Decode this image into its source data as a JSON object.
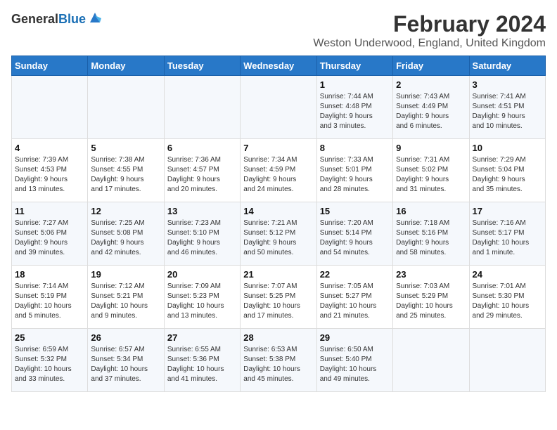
{
  "logo": {
    "general": "General",
    "blue": "Blue"
  },
  "header": {
    "title": "February 2024",
    "subtitle": "Weston Underwood, England, United Kingdom"
  },
  "weekdays": [
    "Sunday",
    "Monday",
    "Tuesday",
    "Wednesday",
    "Thursday",
    "Friday",
    "Saturday"
  ],
  "rows": [
    [
      {
        "day": "",
        "info": ""
      },
      {
        "day": "",
        "info": ""
      },
      {
        "day": "",
        "info": ""
      },
      {
        "day": "",
        "info": ""
      },
      {
        "day": "1",
        "info": "Sunrise: 7:44 AM\nSunset: 4:48 PM\nDaylight: 9 hours\nand 3 minutes."
      },
      {
        "day": "2",
        "info": "Sunrise: 7:43 AM\nSunset: 4:49 PM\nDaylight: 9 hours\nand 6 minutes."
      },
      {
        "day": "3",
        "info": "Sunrise: 7:41 AM\nSunset: 4:51 PM\nDaylight: 9 hours\nand 10 minutes."
      }
    ],
    [
      {
        "day": "4",
        "info": "Sunrise: 7:39 AM\nSunset: 4:53 PM\nDaylight: 9 hours\nand 13 minutes."
      },
      {
        "day": "5",
        "info": "Sunrise: 7:38 AM\nSunset: 4:55 PM\nDaylight: 9 hours\nand 17 minutes."
      },
      {
        "day": "6",
        "info": "Sunrise: 7:36 AM\nSunset: 4:57 PM\nDaylight: 9 hours\nand 20 minutes."
      },
      {
        "day": "7",
        "info": "Sunrise: 7:34 AM\nSunset: 4:59 PM\nDaylight: 9 hours\nand 24 minutes."
      },
      {
        "day": "8",
        "info": "Sunrise: 7:33 AM\nSunset: 5:01 PM\nDaylight: 9 hours\nand 28 minutes."
      },
      {
        "day": "9",
        "info": "Sunrise: 7:31 AM\nSunset: 5:02 PM\nDaylight: 9 hours\nand 31 minutes."
      },
      {
        "day": "10",
        "info": "Sunrise: 7:29 AM\nSunset: 5:04 PM\nDaylight: 9 hours\nand 35 minutes."
      }
    ],
    [
      {
        "day": "11",
        "info": "Sunrise: 7:27 AM\nSunset: 5:06 PM\nDaylight: 9 hours\nand 39 minutes."
      },
      {
        "day": "12",
        "info": "Sunrise: 7:25 AM\nSunset: 5:08 PM\nDaylight: 9 hours\nand 42 minutes."
      },
      {
        "day": "13",
        "info": "Sunrise: 7:23 AM\nSunset: 5:10 PM\nDaylight: 9 hours\nand 46 minutes."
      },
      {
        "day": "14",
        "info": "Sunrise: 7:21 AM\nSunset: 5:12 PM\nDaylight: 9 hours\nand 50 minutes."
      },
      {
        "day": "15",
        "info": "Sunrise: 7:20 AM\nSunset: 5:14 PM\nDaylight: 9 hours\nand 54 minutes."
      },
      {
        "day": "16",
        "info": "Sunrise: 7:18 AM\nSunset: 5:16 PM\nDaylight: 9 hours\nand 58 minutes."
      },
      {
        "day": "17",
        "info": "Sunrise: 7:16 AM\nSunset: 5:17 PM\nDaylight: 10 hours\nand 1 minute."
      }
    ],
    [
      {
        "day": "18",
        "info": "Sunrise: 7:14 AM\nSunset: 5:19 PM\nDaylight: 10 hours\nand 5 minutes."
      },
      {
        "day": "19",
        "info": "Sunrise: 7:12 AM\nSunset: 5:21 PM\nDaylight: 10 hours\nand 9 minutes."
      },
      {
        "day": "20",
        "info": "Sunrise: 7:09 AM\nSunset: 5:23 PM\nDaylight: 10 hours\nand 13 minutes."
      },
      {
        "day": "21",
        "info": "Sunrise: 7:07 AM\nSunset: 5:25 PM\nDaylight: 10 hours\nand 17 minutes."
      },
      {
        "day": "22",
        "info": "Sunrise: 7:05 AM\nSunset: 5:27 PM\nDaylight: 10 hours\nand 21 minutes."
      },
      {
        "day": "23",
        "info": "Sunrise: 7:03 AM\nSunset: 5:29 PM\nDaylight: 10 hours\nand 25 minutes."
      },
      {
        "day": "24",
        "info": "Sunrise: 7:01 AM\nSunset: 5:30 PM\nDaylight: 10 hours\nand 29 minutes."
      }
    ],
    [
      {
        "day": "25",
        "info": "Sunrise: 6:59 AM\nSunset: 5:32 PM\nDaylight: 10 hours\nand 33 minutes."
      },
      {
        "day": "26",
        "info": "Sunrise: 6:57 AM\nSunset: 5:34 PM\nDaylight: 10 hours\nand 37 minutes."
      },
      {
        "day": "27",
        "info": "Sunrise: 6:55 AM\nSunset: 5:36 PM\nDaylight: 10 hours\nand 41 minutes."
      },
      {
        "day": "28",
        "info": "Sunrise: 6:53 AM\nSunset: 5:38 PM\nDaylight: 10 hours\nand 45 minutes."
      },
      {
        "day": "29",
        "info": "Sunrise: 6:50 AM\nSunset: 5:40 PM\nDaylight: 10 hours\nand 49 minutes."
      },
      {
        "day": "",
        "info": ""
      },
      {
        "day": "",
        "info": ""
      }
    ]
  ]
}
